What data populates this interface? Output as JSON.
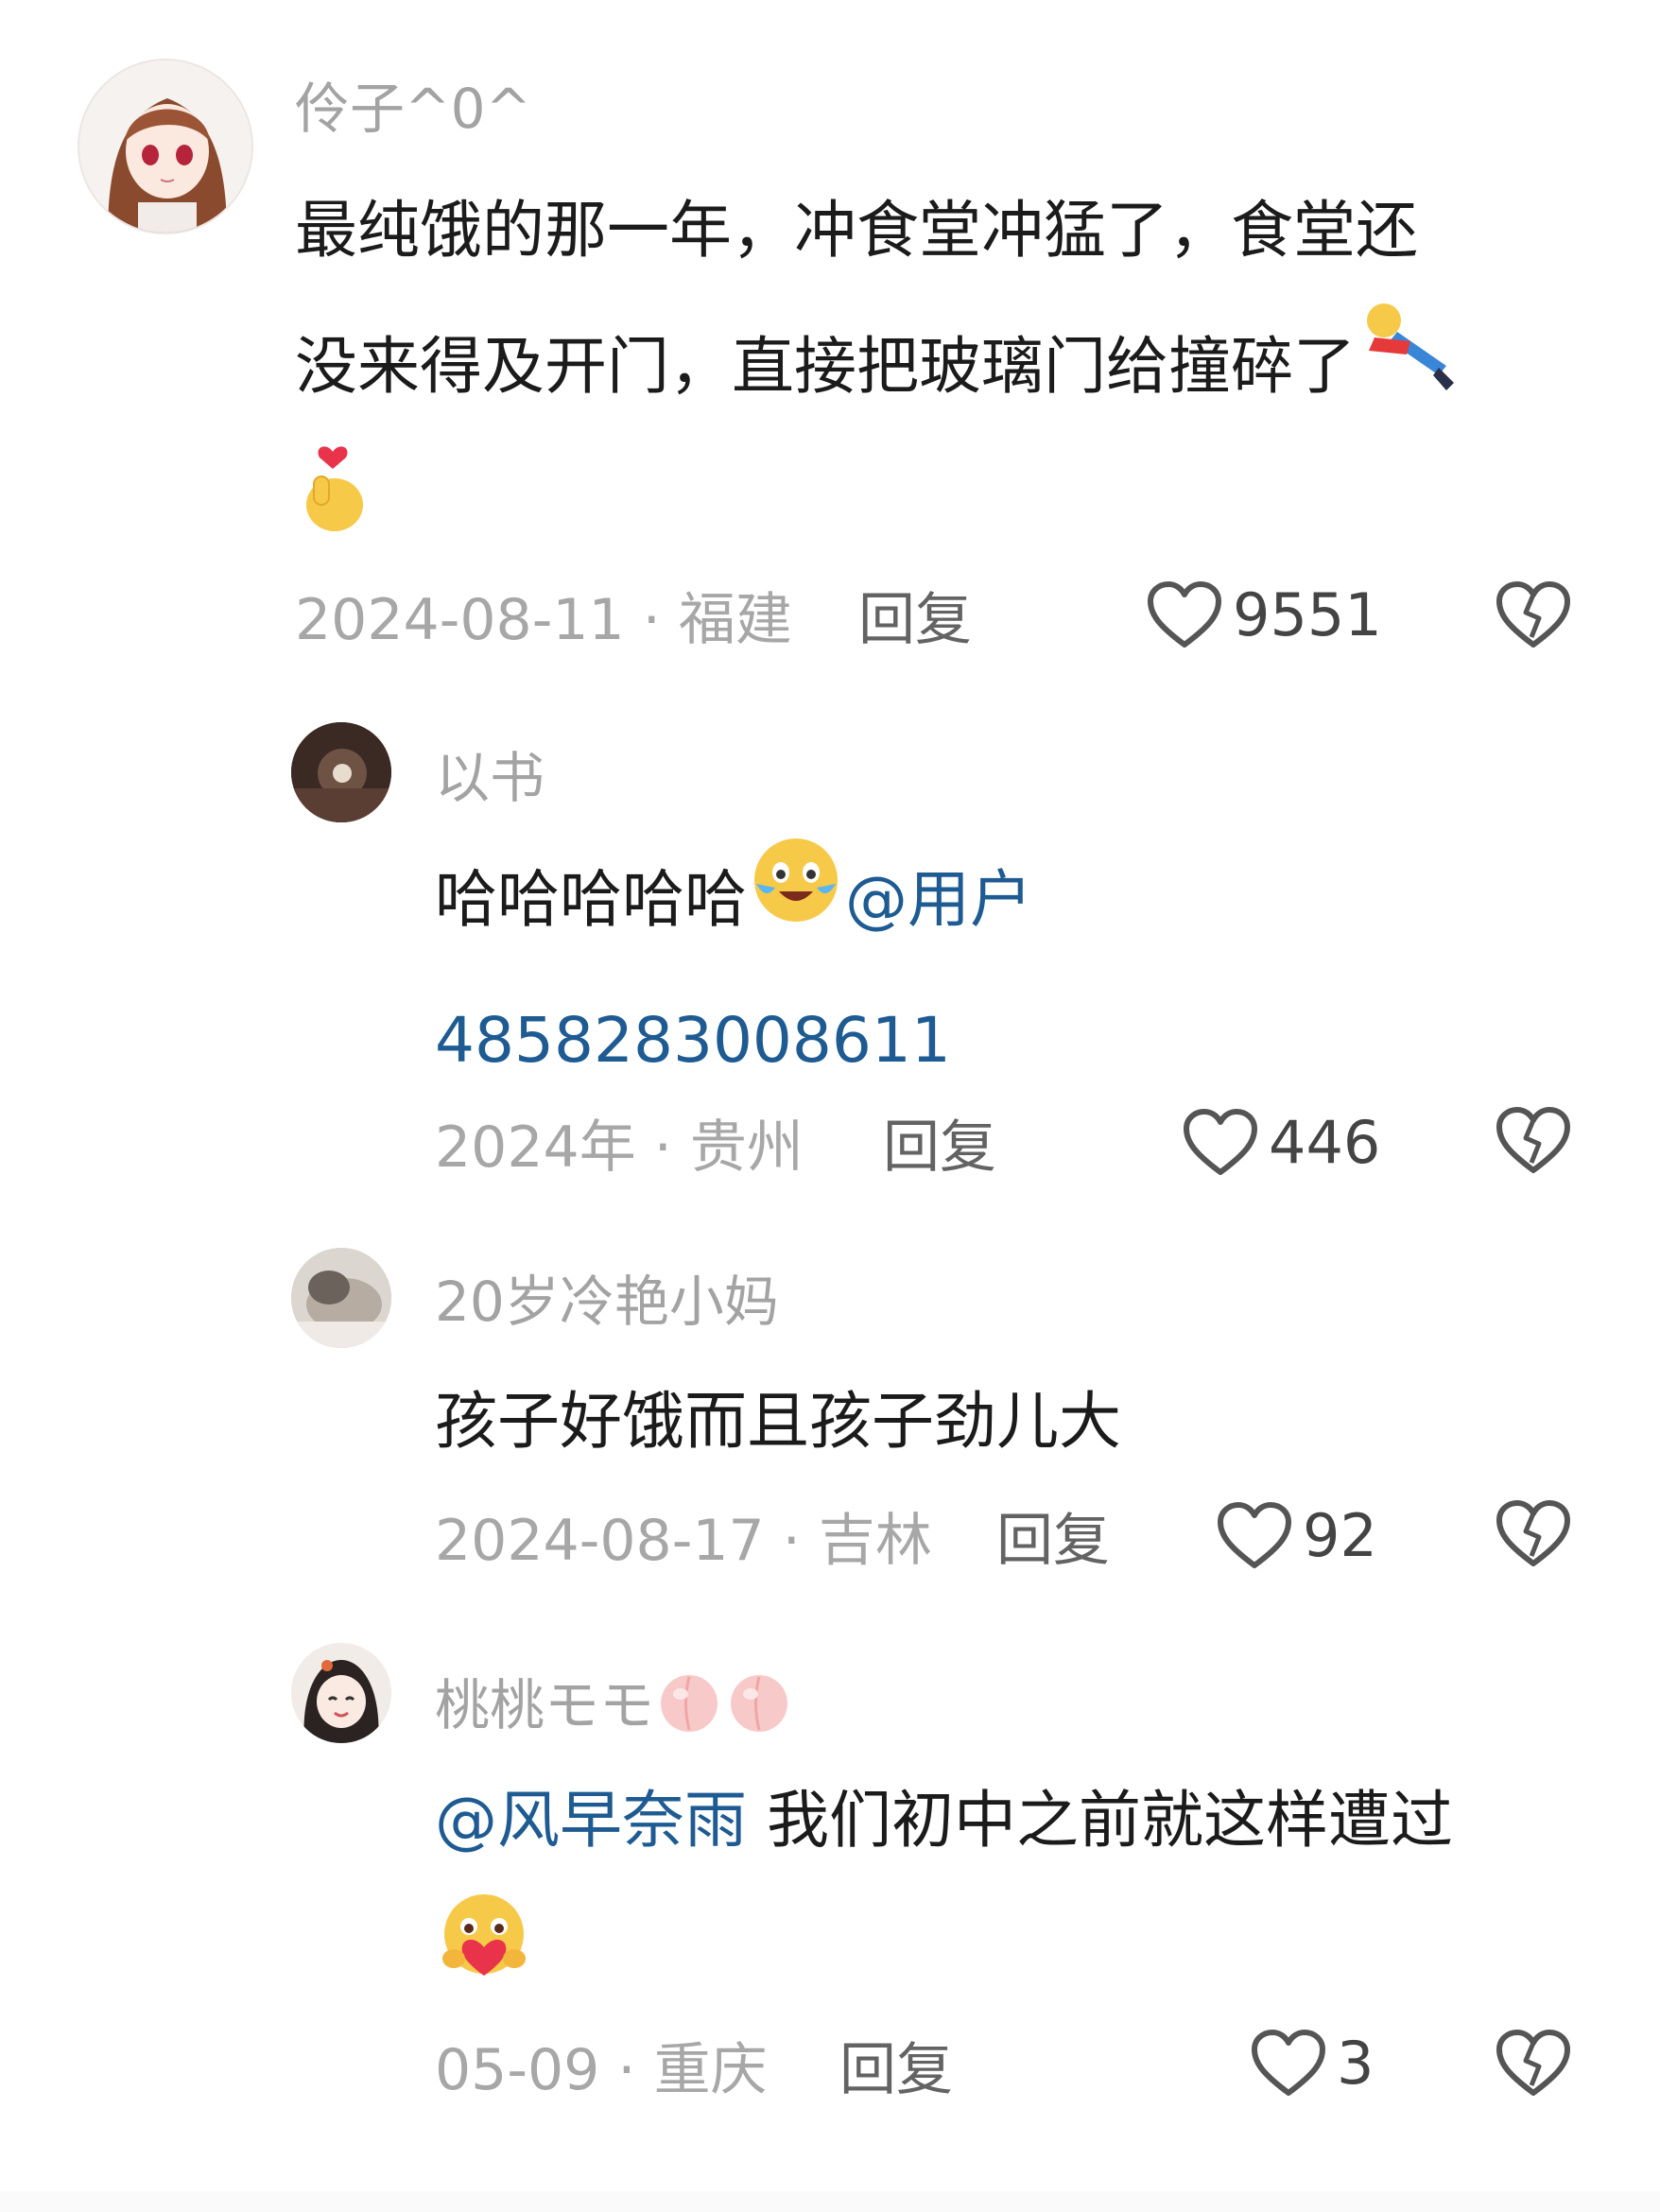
{
  "comments": [
    {
      "username": "伶子^0^",
      "lines": [
        "最纯饿的那一年，冲食堂冲猛了，食堂还",
        "没来得及开门，直接把玻璃门给撞碎了"
      ],
      "date_location": "2024-08-11 · 福建",
      "reply_label": "回复",
      "likes": "9551",
      "emoji": [
        "fallen-person-emoji",
        "finger-heart-emoji"
      ]
    },
    {
      "username": "以书",
      "text": "哈哈哈哈哈",
      "mention": "@用户",
      "mention_cont": "4858283008611",
      "date_location": "2024年 · 贵州",
      "reply_label": "回复",
      "likes": "446",
      "emoji": [
        "laugh-cry-emoji"
      ]
    },
    {
      "username": "20岁冷艳小妈",
      "text": "孩子好饿而且孩子劲儿大",
      "date_location": "2024-08-17 · 吉林",
      "reply_label": "回复",
      "likes": "92"
    },
    {
      "username": "桃桃モモ",
      "mention": "@风早奈雨",
      "text": " 我们初中之前就这样遭过",
      "date_location": "05-09 · 重庆",
      "reply_label": "回复",
      "likes": "3",
      "emoji": [
        "peach-emoji",
        "peach-emoji",
        "heart-hug-emoji"
      ]
    }
  ],
  "colors": {
    "username": "#a3a3a3",
    "body": "#1b1b1b",
    "mention": "#1e5b92",
    "meta": "#a7a7a7",
    "reply": "#636363"
  },
  "icons": [
    "heart-outline-icon",
    "broken-heart-icon"
  ]
}
